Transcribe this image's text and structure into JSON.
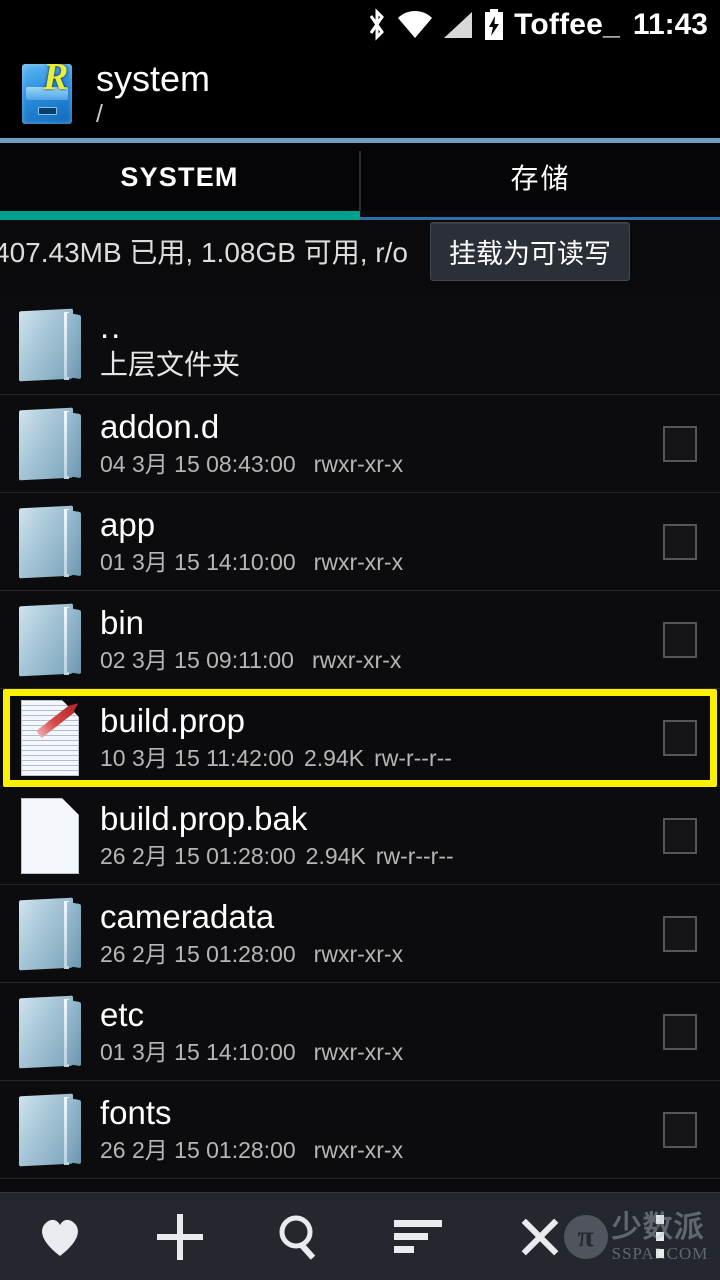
{
  "statusbar": {
    "icons": [
      "bluetooth-icon",
      "wifi-icon",
      "signal-icon",
      "battery-charging-icon"
    ],
    "carrier": "Toffee_",
    "clock": "11:43"
  },
  "header": {
    "app_icon": "root-explorer-icon",
    "title": "system",
    "path": "/"
  },
  "tabs": [
    {
      "label": "SYSTEM",
      "active": true
    },
    {
      "label": "存储",
      "active": false
    }
  ],
  "mountbar": {
    "status": "407.43MB 已用, 1.08GB 可用, r/o",
    "button_label": "挂载为可读写"
  },
  "file_list": [
    {
      "icon": "folder-icon",
      "name": "..",
      "subtitle": "上层文件夹",
      "date": "",
      "size": "",
      "perm": "",
      "checkbox": false,
      "highlighted": false,
      "is_parent": true
    },
    {
      "icon": "folder-icon",
      "name": "addon.d",
      "date": "04 3月 15 08:43:00",
      "size": "",
      "perm": "rwxr-xr-x",
      "checkbox": true,
      "highlighted": false,
      "is_parent": false
    },
    {
      "icon": "folder-icon",
      "name": "app",
      "date": "01 3月 15 14:10:00",
      "size": "",
      "perm": "rwxr-xr-x",
      "checkbox": true,
      "highlighted": false,
      "is_parent": false
    },
    {
      "icon": "folder-icon",
      "name": "bin",
      "date": "02 3月 15 09:11:00",
      "size": "",
      "perm": "rwxr-xr-x",
      "checkbox": true,
      "highlighted": false,
      "is_parent": false
    },
    {
      "icon": "text-file-edit-icon",
      "name": "build.prop",
      "date": "10 3月 15 11:42:00",
      "size": "2.94K",
      "perm": "rw-r--r--",
      "checkbox": true,
      "highlighted": true,
      "is_parent": false
    },
    {
      "icon": "file-icon",
      "name": "build.prop.bak",
      "date": "26 2月 15 01:28:00",
      "size": "2.94K",
      "perm": "rw-r--r--",
      "checkbox": true,
      "highlighted": false,
      "is_parent": false
    },
    {
      "icon": "folder-icon",
      "name": "cameradata",
      "date": "26 2月 15 01:28:00",
      "size": "",
      "perm": "rwxr-xr-x",
      "checkbox": true,
      "highlighted": false,
      "is_parent": false
    },
    {
      "icon": "folder-icon",
      "name": "etc",
      "date": "01 3月 15 14:10:00",
      "size": "",
      "perm": "rwxr-xr-x",
      "checkbox": true,
      "highlighted": false,
      "is_parent": false
    },
    {
      "icon": "folder-icon",
      "name": "fonts",
      "date": "26 2月 15 01:28:00",
      "size": "",
      "perm": "rwxr-xr-x",
      "checkbox": true,
      "highlighted": false,
      "is_parent": false
    }
  ],
  "bottombar": {
    "items": [
      "favorite-heart-icon",
      "add-plus-icon",
      "search-icon",
      "sort-icon",
      "close-x-icon",
      "overflow-menu-icon"
    ]
  },
  "watermark": {
    "logo": "pi-logo-icon",
    "pi_glyph": "π",
    "chinese": "少数派",
    "english": "SSPAI.COM"
  },
  "colors": {
    "tab_indicator": "#00a08f",
    "tab_inactive_underline": "#2f6ea8",
    "highlight_border": "#fbf000",
    "header_rule": "#6e9dc0",
    "bottombar_bg": "#24272e"
  }
}
